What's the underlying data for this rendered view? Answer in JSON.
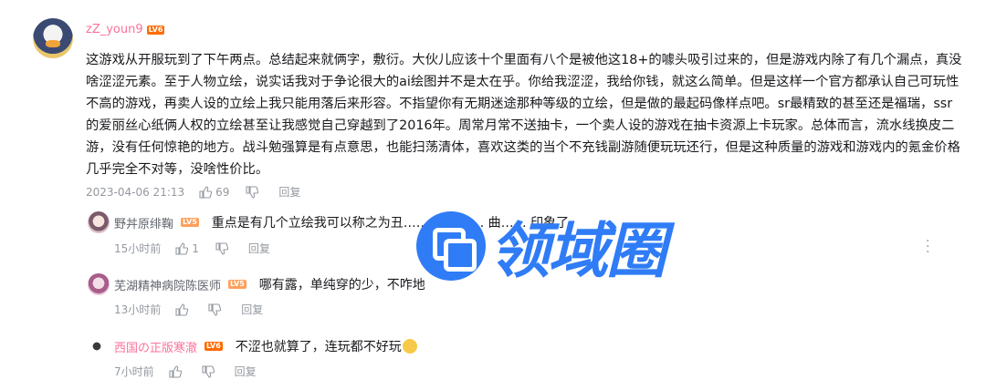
{
  "main_comment": {
    "username": "zZ_youn9",
    "level": "LV6",
    "text": "这游戏从开服玩到了下午两点。总结起来就俩字，敷衍。大伙儿应该十个里面有八个是被他这18+的噱头吸引过来的，但是游戏内除了有几个漏点，真没啥涩涩元素。至于人物立绘，说实话我对于争论很大的ai绘图并不是太在乎。你给我涩涩，我给你钱，就这么简单。但是这样一个官方都承认自己可玩性不高的游戏，再卖人设的立绘上我只能用落后来形容。不指望你有无期迷途那种等级的立绘，但是做的最起码像样点吧。sr最精致的甚至还是福瑞，ssr的爱丽丝心纸俩人权的立绘甚至让我感觉自己穿越到了2016年。周常月常不送抽卡，一个卖人设的游戏在抽卡资源上卡玩家。总体而言，流水线换皮二游，没有任何惊艳的地方。战斗勉强算是有点意思，也能扫荡清体，喜欢这类的当个不充钱副游随便玩玩还行，但是这种质量的游戏和游戏内的氪金价格几乎完全不对等，没啥性价比。",
    "time": "2023-04-06 21:13",
    "likes": "69",
    "reply_label": "回复"
  },
  "replies": [
    {
      "username": "野丼原绯鞠",
      "level": "LV5",
      "text": "重点是有几个立绘我可以称之为丑…… 真…的… 曲…… 印象了",
      "time": "15小时前",
      "likes": "1",
      "reply_label": "回复"
    },
    {
      "username": "芜湖精神病院陈医师",
      "level": "LV5",
      "text": "哪有露，单纯穿的少，不咋地",
      "time": "13小时前",
      "likes": "",
      "reply_label": "回复"
    },
    {
      "username": "西国の正版寒澈",
      "level": "LV6",
      "text": "不涩也就算了，连玩都不好玩",
      "time": "7小时前",
      "likes": "",
      "reply_label": "回复"
    }
  ],
  "watermark": {
    "text": "领域圈"
  },
  "colors": {
    "username_pink": "#fb7299",
    "meta_gray": "#9499a0",
    "watermark_blue": "#2f7cf6"
  }
}
